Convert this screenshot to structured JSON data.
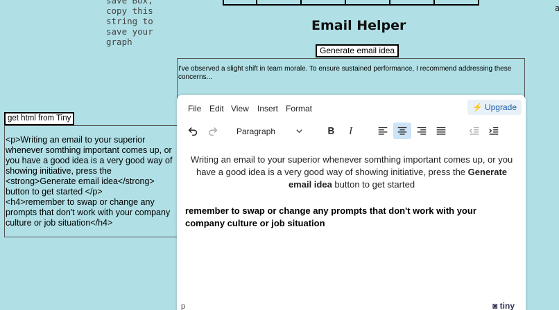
{
  "side_note": {
    "lines": [
      "save Box,",
      "copy this",
      "string to",
      "save your",
      "graph"
    ]
  },
  "stray_text": "a",
  "app": {
    "title": "Email Helper",
    "generate_button": "Generate email idea",
    "generated_email": "I've observed a slight shift in team morale. To ensure sustained performance, I recommend addressing these concerns..."
  },
  "html_export": {
    "button_label": "get html from Tiny",
    "html": "<p>Writing an email to your superior whenever somthing important comes up, or you have a good idea is a very good way of showing initiative, press the <strong>Generate email idea</strong> button to get started </p>\n<h4>remember to swap or change any prompts that don't work with your company culture or job situation</h4>"
  },
  "editor": {
    "menu": [
      "File",
      "Edit",
      "View",
      "Insert",
      "Format"
    ],
    "upgrade_label": "Upgrade",
    "block_format": "Paragraph",
    "active_alignment": "align-center",
    "content": {
      "paragraph_before": "Writing an email to your superior whenever somthing important comes up, or you have a good idea is a very good way of showing initiative, press the ",
      "paragraph_strong": "Generate email idea",
      "paragraph_after": " button to get started",
      "heading": "remember to swap or change any prompts that don't work with your company culture or job situation"
    },
    "status_path": "p",
    "brand": "tiny"
  },
  "colors": {
    "background": "#b0dfe5",
    "upgrade_text": "#1a5fa8",
    "upgrade_icon": "#f26f21",
    "active_button": "#cde3f6"
  }
}
